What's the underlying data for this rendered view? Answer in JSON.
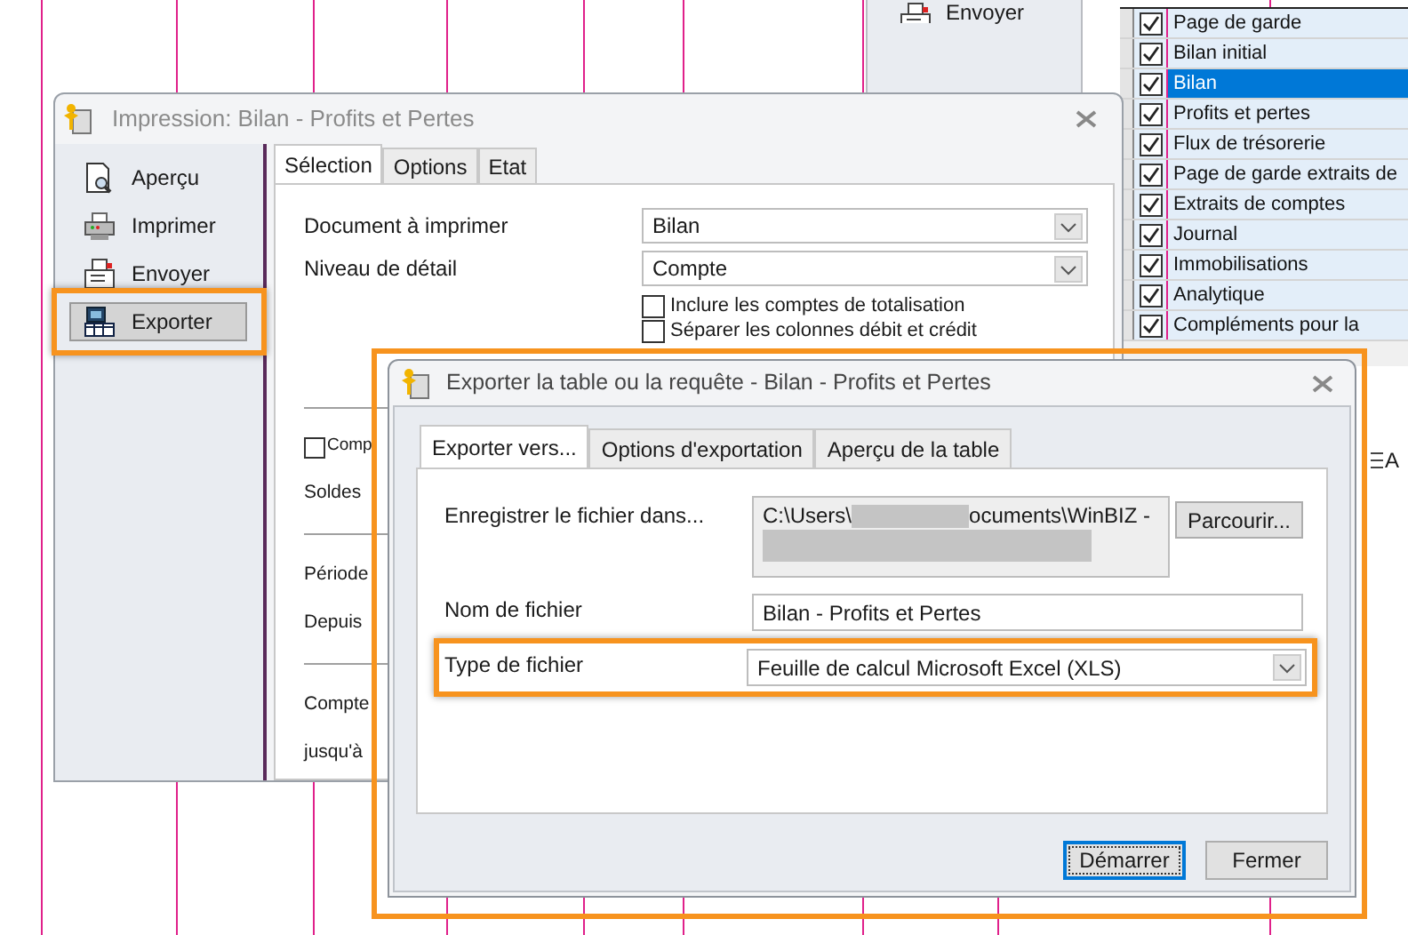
{
  "background_window": {
    "sidebar_item": {
      "label": "Envoyer",
      "kind": "send"
    },
    "list_items": [
      {
        "label": "Page de garde",
        "checked": true,
        "selected": false
      },
      {
        "label": "Bilan initial",
        "checked": true,
        "selected": false
      },
      {
        "label": "Bilan",
        "checked": true,
        "selected": true
      },
      {
        "label": "Profits et pertes",
        "checked": true,
        "selected": false
      },
      {
        "label": "Flux de trésorerie",
        "checked": true,
        "selected": false
      },
      {
        "label": "Page de garde extraits de",
        "checked": true,
        "selected": false
      },
      {
        "label": "Extraits de comptes",
        "checked": true,
        "selected": false
      },
      {
        "label": "Journal",
        "checked": true,
        "selected": false
      },
      {
        "label": "Immobilisations",
        "checked": true,
        "selected": false
      },
      {
        "label": "Analytique",
        "checked": true,
        "selected": false
      },
      {
        "label": "Compléments pour la",
        "checked": true,
        "selected": false
      }
    ],
    "toolbar_text": "A"
  },
  "print_dialog": {
    "title": "Impression: Bilan - Profits et Pertes",
    "sidebar": [
      {
        "label": "Aperçu",
        "kind": "preview",
        "selected": false,
        "highlighted": false
      },
      {
        "label": "Imprimer",
        "kind": "print",
        "selected": false,
        "highlighted": false
      },
      {
        "label": "Envoyer",
        "kind": "send",
        "selected": false,
        "highlighted": false
      },
      {
        "label": "Exporter",
        "kind": "export",
        "selected": true,
        "highlighted": true
      }
    ],
    "tabs": [
      {
        "label": "Sélection",
        "selected": true
      },
      {
        "label": "Options",
        "selected": false
      },
      {
        "label": "Etat",
        "selected": false
      }
    ],
    "fields": [
      {
        "label": "Document à imprimer",
        "value": "Bilan"
      },
      {
        "label": "Niveau de détail",
        "value": "Compte"
      }
    ],
    "checkboxes": [
      {
        "label": "Inclure les comptes de totalisation",
        "checked": false
      },
      {
        "label": "Séparer les colonnes débit et crédit",
        "checked": false
      }
    ],
    "lower_rows": [
      {
        "kind": "separator"
      },
      {
        "kind": "checkbox",
        "label": "Comp",
        "checked": false
      },
      {
        "kind": "label",
        "label": "Soldes"
      },
      {
        "kind": "separator"
      },
      {
        "kind": "label",
        "label": "Période"
      },
      {
        "kind": "label",
        "label": "Depuis"
      },
      {
        "kind": "separator"
      },
      {
        "kind": "label",
        "label": "Compte"
      },
      {
        "kind": "label",
        "label": "jusqu'à"
      }
    ]
  },
  "export_dialog": {
    "title": "Exporter la table ou la requête - Bilan - Profits et Pertes",
    "highlighted": true,
    "tabs": [
      {
        "label": "Exporter vers...",
        "selected": true
      },
      {
        "label": "Options d'exportation",
        "selected": false
      },
      {
        "label": "Aperçu de la table",
        "selected": false
      }
    ],
    "folder_label": "Enregistrer le fichier dans...",
    "folder_path": {
      "prefix": "C:\\Users\\",
      "suffix": "ocuments\\WinBIZ -",
      "redacted": true
    },
    "browse_button": "Parcourir...",
    "filename_label": "Nom de fichier",
    "filename": "Bilan - Profits et Pertes",
    "type_label": "Type de fichier",
    "type_value": "Feuille de calcul Microsoft Excel (XLS)",
    "type_highlighted": true,
    "buttons": [
      {
        "label": "Démarrer",
        "focused": true
      },
      {
        "label": "Fermer",
        "focused": false
      }
    ]
  }
}
